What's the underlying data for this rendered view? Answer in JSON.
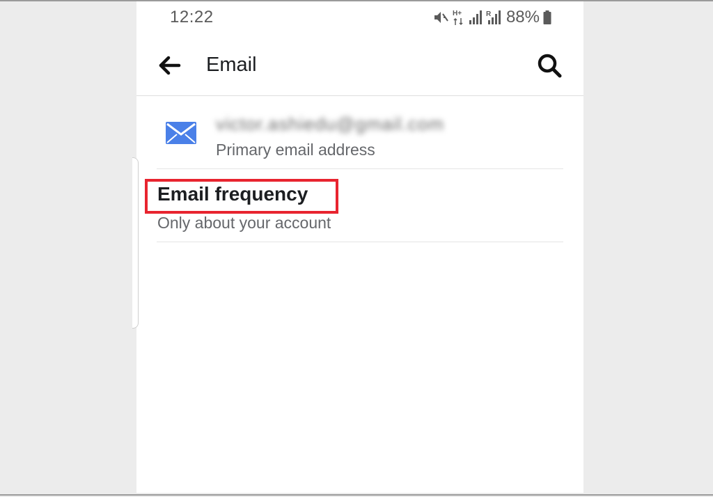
{
  "status_bar": {
    "time": "12:22",
    "network_type": "H+",
    "sim_label": "R",
    "battery": "88%",
    "icons": [
      "mute-icon",
      "data-arrows-icon",
      "signal-icon",
      "roaming-signal-icon",
      "battery-icon"
    ]
  },
  "app_bar": {
    "title": "Email",
    "back_icon": "arrow-left-icon",
    "search_icon": "search-icon"
  },
  "email_entry": {
    "address": "victor.ashiedu@gmail.com",
    "label": "Primary email address",
    "icon": "envelope-icon",
    "icon_color": "#4a80e8"
  },
  "frequency_entry": {
    "title": "Email frequency",
    "subtitle": "Only about your account",
    "highlight_color": "#e8242f"
  }
}
